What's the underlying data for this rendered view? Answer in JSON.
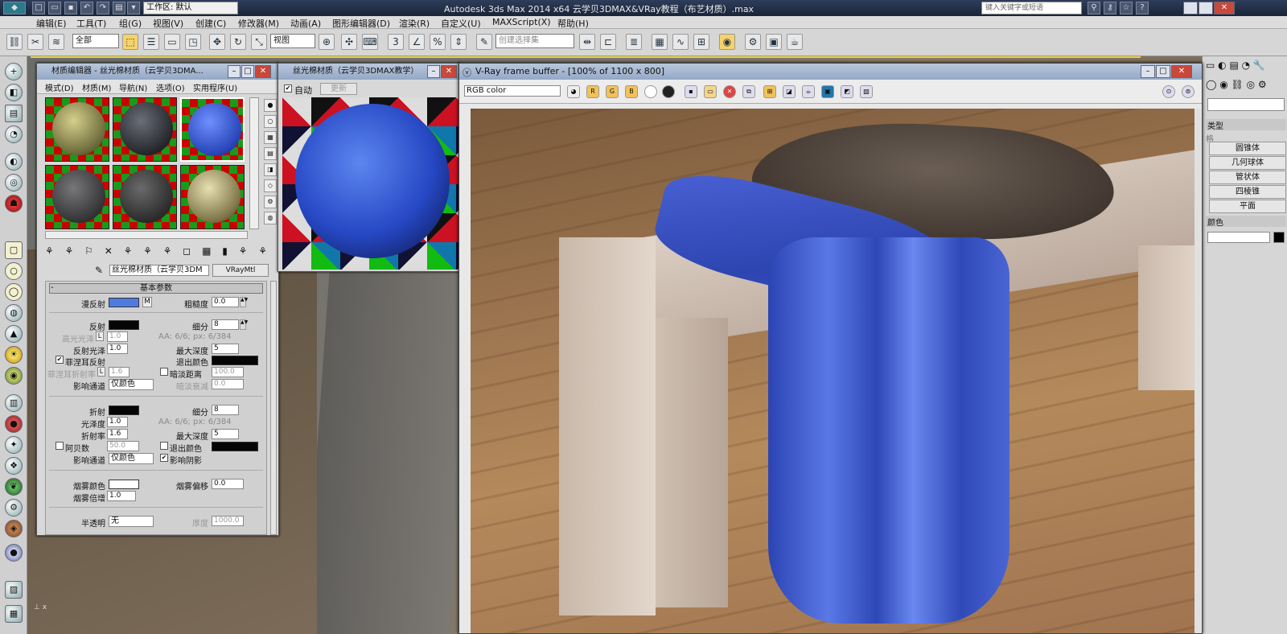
{
  "titlebar": {
    "workspace": "工作区: 默认",
    "title": "Autodesk 3ds Max  2014 x64      云学贝3DMAX&VRay教程（布艺材质）.max",
    "search_placeholder": "键入关键字或短语"
  },
  "menubar": [
    "编辑(E)",
    "工具(T)",
    "组(G)",
    "视图(V)",
    "创建(C)",
    "修改器(M)",
    "动画(A)",
    "图形编辑器(D)",
    "渲染(R)",
    "自定义(U)",
    "MAXScript(X)",
    "帮助(H)"
  ],
  "toolbar": {
    "selection_filter": "全部",
    "ref_coord": "视图",
    "named_selection": "创建选择集"
  },
  "material_editor": {
    "title": "材质编辑器 - 丝光棉材质（云学贝3DMA...",
    "menu": [
      "模式(D)",
      "材质(M)",
      "导航(N)",
      "选项(O)",
      "实用程序(U)"
    ],
    "material_name": "丝光棉材质（云学贝3DM",
    "material_type": "VRayMtl",
    "rollout_title": "基本参数",
    "diffuse": {
      "label": "漫反射",
      "map": "M",
      "color": "#4f7be0"
    },
    "roughness": {
      "label": "粗糙度",
      "value": "0.0"
    },
    "reflect": {
      "label": "反射",
      "color": "#050505"
    },
    "subdivs": {
      "label": "细分",
      "value": "8"
    },
    "hilight_gloss": {
      "label": "高光光泽",
      "lock": "L",
      "value": "1.0"
    },
    "aa_info": "AA: 6/6; px: 6/384",
    "refl_gloss": {
      "label": "反射光泽",
      "value": "1.0"
    },
    "max_depth": {
      "label": "最大深度",
      "value": "5"
    },
    "fresnel": {
      "label": "菲涅耳反射",
      "checked": "✔"
    },
    "exit_color": {
      "label": "退出颜色",
      "color": "#050505"
    },
    "fresnel_ior": {
      "label": "菲涅耳折射率",
      "lock": "L",
      "value": "1.6"
    },
    "dim_distance": {
      "label": "暗淡距离",
      "value": "100.0"
    },
    "affect_channels": {
      "label": "影响通道",
      "value": "仅颜色"
    },
    "dim_falloff": {
      "label": "暗淡衰减",
      "value": "0.0"
    },
    "refract": {
      "label": "折射",
      "color": "#050505"
    },
    "refr_subdivs": {
      "label": "细分",
      "value": "8"
    },
    "glossiness": {
      "label": "光泽度",
      "value": "1.0"
    },
    "refr_aa": "AA: 6/6; px: 6/384",
    "ior": {
      "label": "折射率",
      "value": "1.6"
    },
    "refr_max_depth": {
      "label": "最大深度",
      "value": "5"
    },
    "abbe": {
      "label": "阿贝数",
      "value": "50.0"
    },
    "refr_exit_color": {
      "label": "退出颜色",
      "color": "#050505"
    },
    "refr_affect_channels": {
      "label": "影响通道",
      "value": "仅颜色"
    },
    "affect_shadows": {
      "label": "影响阴影",
      "checked": "✔"
    },
    "fog_color": {
      "label": "烟雾颜色",
      "color": "#ffffff"
    },
    "fog_bias": {
      "label": "烟雾偏移",
      "value": "0.0"
    },
    "fog_mult": {
      "label": "烟雾倍增",
      "value": "1.0"
    },
    "translucency": {
      "label": "半透明",
      "value": "无"
    },
    "thickness": {
      "label": "厚度",
      "value": "1000.0"
    }
  },
  "preview_window": {
    "title": "丝光棉材质（云学贝3DMAX教学）",
    "auto_label": "自动",
    "update_label": "更新"
  },
  "vfb": {
    "title": "V-Ray frame buffer - [100% of 1100 x 800]",
    "channel": "RGB color"
  },
  "right_panel": {
    "header": "类型",
    "sub": "格",
    "buttons": [
      "圆锥体",
      "几何球体",
      "管状体",
      "四棱锥",
      "平面"
    ],
    "color_header": "颜色"
  }
}
